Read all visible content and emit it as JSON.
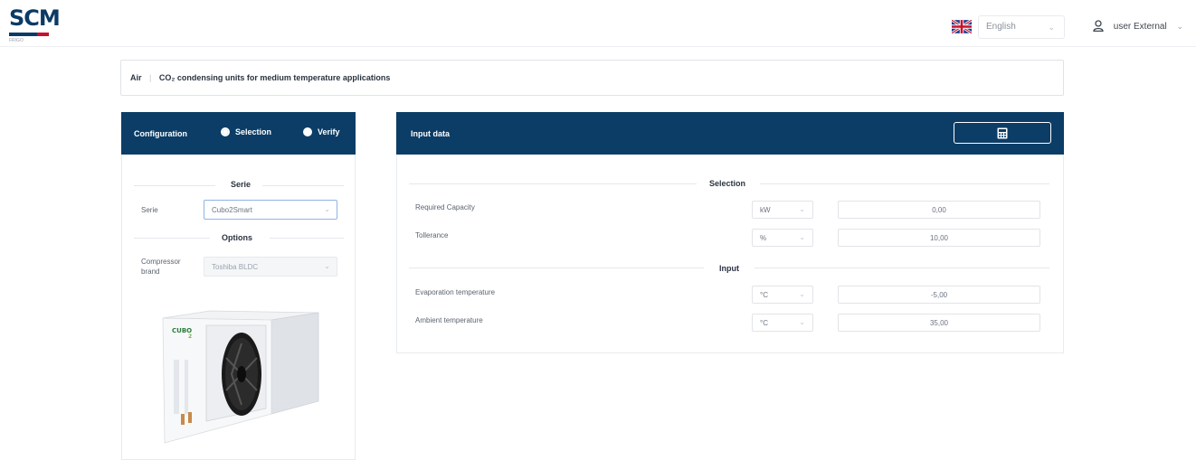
{
  "header": {
    "logo_text": "SCM",
    "logo_tagline": "FRIGO",
    "language": {
      "selected": "English",
      "flag_icon": "uk-flag-icon"
    },
    "user": {
      "name": "user External",
      "icon": "user-icon"
    }
  },
  "breadcrumb": {
    "root": "Air",
    "current": "CO₂ condensing units for medium temperature applications"
  },
  "config_panel": {
    "title": "Configuration",
    "modes": [
      {
        "label": "Selection",
        "selected": true
      },
      {
        "label": "Verify",
        "selected": false
      }
    ],
    "serie_section": "Serie",
    "serie_label": "Serie",
    "serie_value": "Cubo2Smart",
    "options_section": "Options",
    "compressor_label_line1": "Compressor",
    "compressor_label_line2": "brand",
    "compressor_value": "Toshiba BLDC"
  },
  "input_panel": {
    "title": "Input data",
    "calc_icon": "calculator-icon",
    "selection_section": "Selection",
    "input_section": "Input",
    "rows": [
      {
        "label": "Required Capacity",
        "unit": "kW",
        "value": "0,00"
      },
      {
        "label": "Tollerance",
        "unit": "%",
        "value": "10,00"
      },
      {
        "label": "Evaporation temperature",
        "unit": "°C",
        "value": "-5,00"
      },
      {
        "label": "Ambient temperature",
        "unit": "°C",
        "value": "35,00"
      }
    ]
  },
  "colors": {
    "primary": "#0b3d66",
    "accent_red": "#c8102e"
  }
}
